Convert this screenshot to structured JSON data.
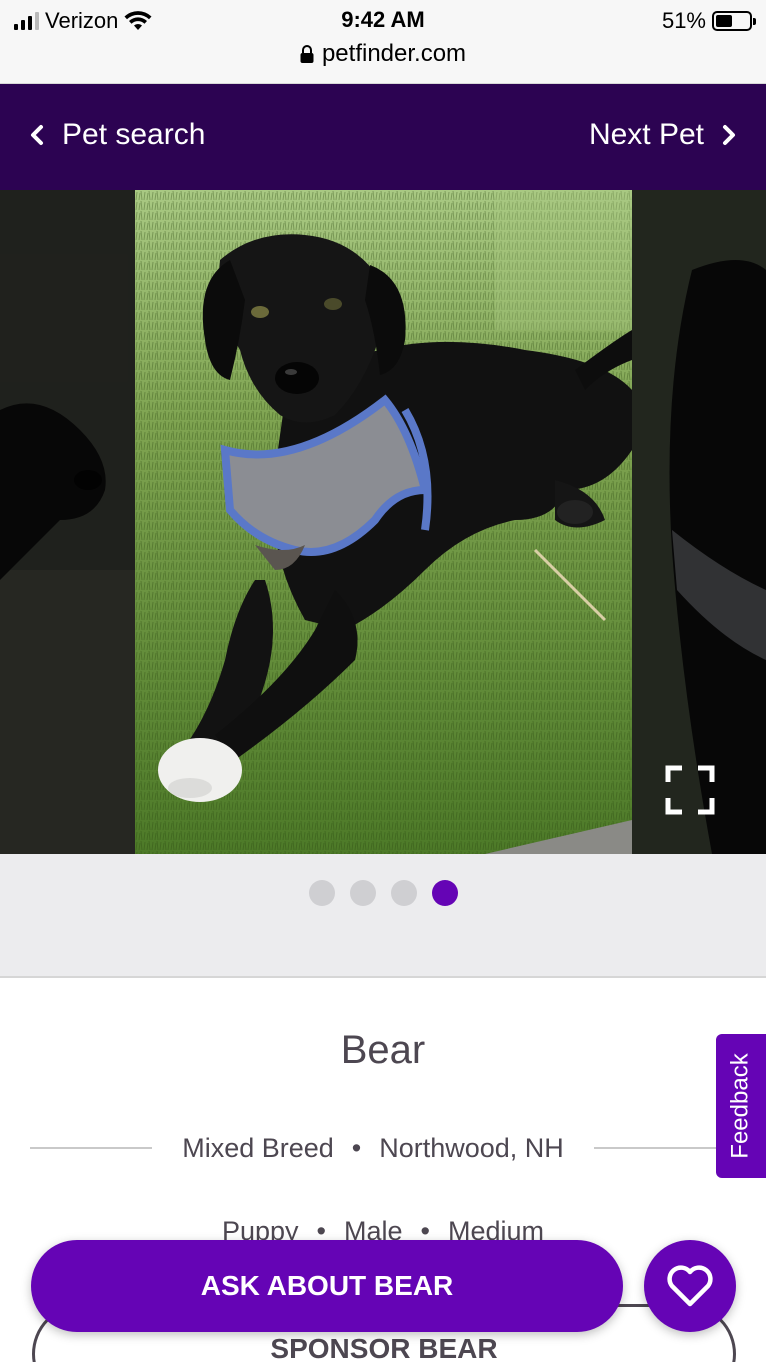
{
  "status_bar": {
    "carrier": "Verizon",
    "time": "9:42 AM",
    "battery": "51%",
    "battery_level": 0.51,
    "url": "petfinder.com"
  },
  "nav": {
    "back_label": "Pet search",
    "next_label": "Next Pet",
    "background": "#2c0352"
  },
  "gallery": {
    "photo_count": 4,
    "active_index": 3,
    "main_photo_icon": "photo-black-puppy-on-grass",
    "expand_icon": "expand-icon"
  },
  "pet": {
    "name": "Bear",
    "breed": "Mixed Breed",
    "location": "Northwood, NH",
    "age": "Puppy",
    "gender": "Male",
    "size": "Medium",
    "separator": "•"
  },
  "feedback_label": "Feedback",
  "actions": {
    "ask_label": "ASK ABOUT BEAR",
    "sponsor_label": "SPONSOR BEAR",
    "favorite_icon": "heart-icon"
  },
  "colors": {
    "brand_purple": "#6504b5",
    "header_purple": "#2c0352"
  }
}
